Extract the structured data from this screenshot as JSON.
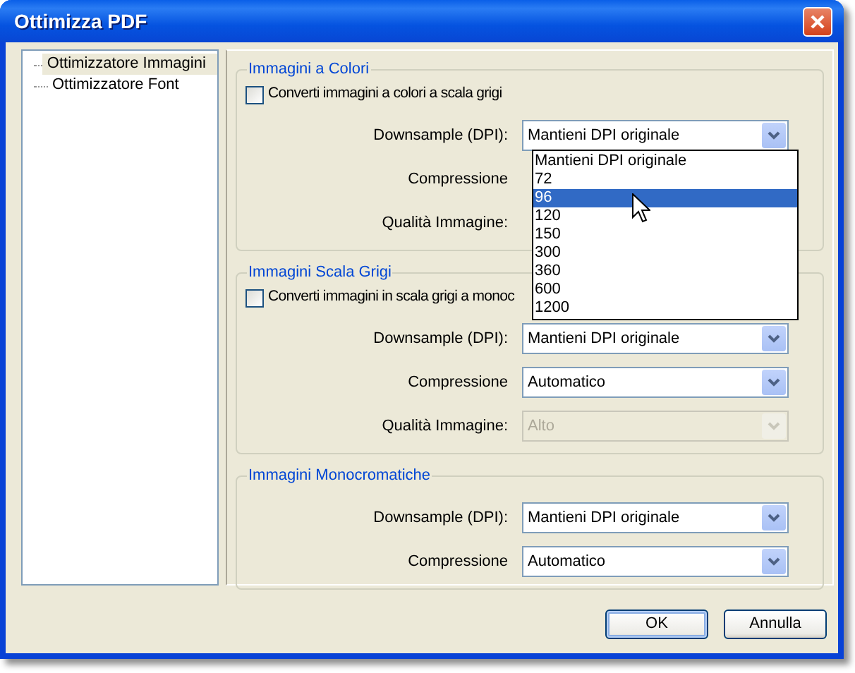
{
  "window": {
    "title": "Ottimizza PDF"
  },
  "tree": [
    {
      "label": "Ottimizzatore Immagini",
      "selected": true
    },
    {
      "label": "Ottimizzatore Font",
      "selected": false
    }
  ],
  "groups": [
    {
      "title": "Immagini a Colori",
      "checkbox": {
        "label": "Converti immagini a colori a scala grigi",
        "checked": false
      },
      "rows": [
        {
          "label": "Downsample (DPI):",
          "value": "Mantieni DPI originale",
          "disabled": false
        },
        {
          "label": "Compressione"
        },
        {
          "label": "Qualità Immagine:"
        }
      ]
    },
    {
      "title": "Immagini Scala Grigi",
      "checkbox": {
        "label": "Converti immagini in scala grigi a monoc",
        "checked": false
      },
      "rows": [
        {
          "label": "Downsample (DPI):",
          "value": "Mantieni DPI originale",
          "disabled": false
        },
        {
          "label": "Compressione",
          "value": "Automatico",
          "disabled": false
        },
        {
          "label": "Qualità Immagine:",
          "value": "Alto",
          "disabled": true
        }
      ]
    },
    {
      "title": "Immagini Monocromatiche",
      "rows": [
        {
          "label": "Downsample (DPI):",
          "value": "Mantieni DPI originale",
          "disabled": false
        },
        {
          "label": "Compressione",
          "value": "Automatico",
          "disabled": false
        }
      ]
    }
  ],
  "dropdown_list": {
    "items": [
      {
        "label": "Mantieni DPI originale",
        "selected": false
      },
      {
        "label": "72",
        "selected": false
      },
      {
        "label": "96",
        "selected": true
      },
      {
        "label": "120",
        "selected": false
      },
      {
        "label": "150",
        "selected": false
      },
      {
        "label": "300",
        "selected": false
      },
      {
        "label": "360",
        "selected": false
      },
      {
        "label": "600",
        "selected": false
      },
      {
        "label": "1200",
        "selected": false
      }
    ]
  },
  "buttons": [
    {
      "label": "OK",
      "default": true
    },
    {
      "label": "Annulla",
      "default": false
    }
  ]
}
